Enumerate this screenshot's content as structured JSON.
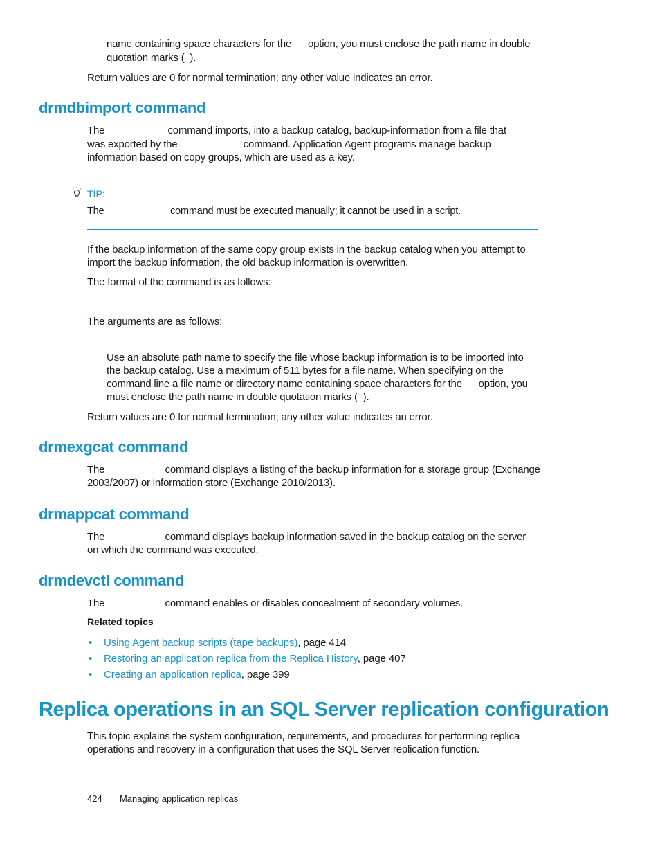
{
  "intro": {
    "line1": "name containing space characters for the      option, you must enclose the path name in double",
    "line2": "quotation marks (  ).",
    "return_values": "Return values are 0 for normal termination; any other value indicates an error."
  },
  "drmdbimport": {
    "heading": "drmdbimport command",
    "para1_line1": "The                       command imports, into a backup catalog, backup-information from a file that",
    "para1_line2": "was exported by the                        command. Application Agent programs manage backup",
    "para1_line3": "information based on copy groups, which are used as a key.",
    "tip": {
      "label": "TIP:",
      "text": "The                         command must be executed manually; it cannot be used in a script."
    },
    "para2_line1": "If the backup information of the same copy group exists in the backup catalog when you attempt to",
    "para2_line2": "import the backup information, the old backup information is overwritten.",
    "format_intro": "The format of the command is as follows:",
    "args_intro": "The arguments are as follows:",
    "arg_desc_line1": "Use an absolute path name to specify the file whose backup information is to be imported into",
    "arg_desc_line2": "the backup catalog. Use a maximum of 511 bytes for a file name. When specifying on the",
    "arg_desc_line3": "command line a file name or directory name containing space characters for the      option, you",
    "arg_desc_line4": "must enclose the path name in double quotation marks (  ).",
    "return_values": "Return values are 0 for normal termination; any other value indicates an error."
  },
  "drmexgcat": {
    "heading": "drmexgcat command",
    "line1": "The                      command displays a listing of the backup information for a storage group (Exchange",
    "line2": "2003/2007) or information store (Exchange 2010/2013)."
  },
  "drmappcat": {
    "heading": "drmappcat command",
    "line1": "The                      command displays backup information saved in the backup catalog on the server",
    "line2": "on which the command was executed."
  },
  "drmdevctl": {
    "heading": "drmdevctl command",
    "line1": "The                      command enables or disables concealment of secondary volumes.",
    "related_label": "Related topics",
    "related": [
      {
        "link": "Using Agent backup scripts (tape backups)",
        "suffix": ", page 414"
      },
      {
        "link": "Restoring an application replica from the Replica History",
        "suffix": ", page 407"
      },
      {
        "link": "Creating an application replica",
        "suffix": ", page 399"
      }
    ]
  },
  "replica_section": {
    "heading": "Replica operations in an SQL Server replication configuration",
    "line1": "This topic explains the system configuration, requirements, and procedures for performing replica",
    "line2": "operations and recovery in a configuration that uses the SQL Server replication function."
  },
  "footer": {
    "page_number": "424",
    "chapter": "Managing application replicas"
  },
  "colors": {
    "accent": "#1a93c6",
    "text": "#1a1a1a"
  }
}
